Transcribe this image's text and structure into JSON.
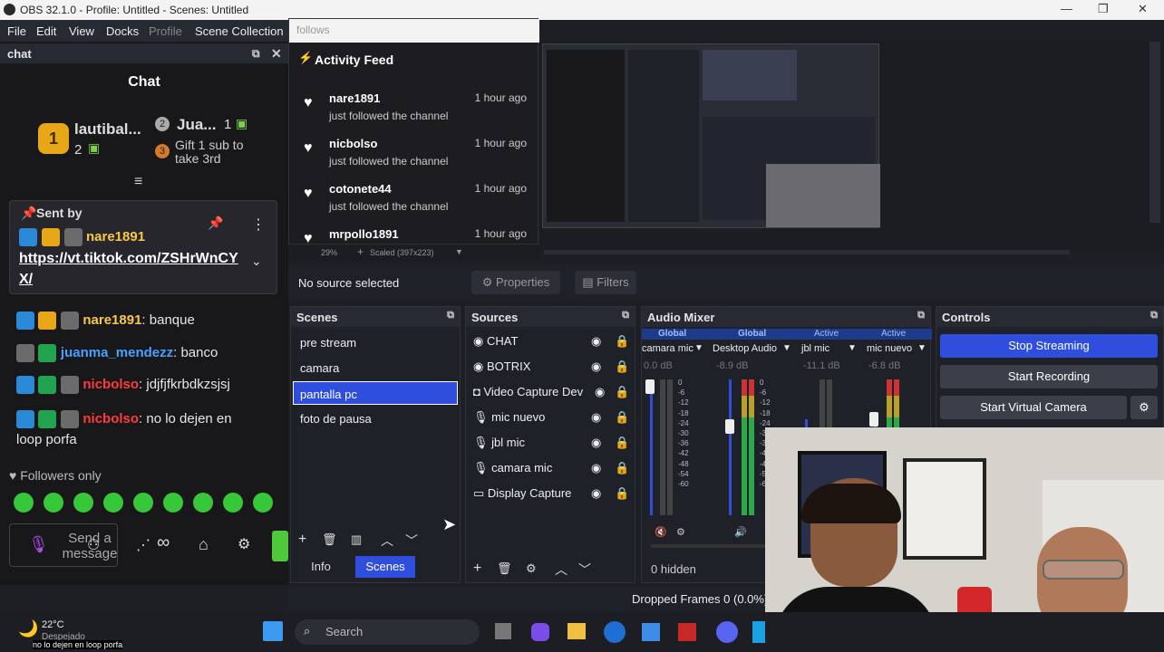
{
  "window": {
    "title": "OBS 32.1.0 - Profile: Untitled - Scenes: Untitled"
  },
  "menu": [
    "File",
    "Edit",
    "View",
    "Docks",
    "Profile",
    "Scene Collection"
  ],
  "chat": {
    "dock_title": "chat",
    "heading": "Chat",
    "top1_name": "lautibal...",
    "top1_count": "2",
    "top2_name": "Jua...",
    "top2_count": "1",
    "top3_text": "Gift 1 sub to take 3rd",
    "pinned_label": "Sent by",
    "pinned_user": "nare1891",
    "pinned_link": "https://vt.tiktok.com/ZSHrWnCYX/",
    "messages": [
      {
        "user": "nare1891",
        "user_color": "#f7c948",
        "text": ": banque"
      },
      {
        "user": "juanma_mendezz",
        "user_color": "#4aa0ff",
        "text": ": banco"
      },
      {
        "user": "nicbolso",
        "user_color": "#ff3b3b",
        "text": ": jdjfjfkrbdkzsjsj"
      },
      {
        "user": "nicbolso",
        "user_color": "#ff3b3b",
        "text": ": no lo dejen en loop porfa"
      }
    ],
    "followers_only": "Followers only",
    "send_placeholder": "Send a message",
    "infinity": "∞"
  },
  "follows": {
    "dock_title": "follows",
    "title": "Activity Feed",
    "items": [
      {
        "name": "nare1891",
        "sub": "just followed the channel",
        "time": "1 hour ago"
      },
      {
        "name": "nicbolso",
        "sub": "just followed the channel",
        "time": "1 hour ago"
      },
      {
        "name": "cotonete44",
        "sub": "just followed the channel",
        "time": "1 hour ago"
      },
      {
        "name": "mrpollo1891",
        "sub": "",
        "time": "1 hour ago"
      }
    ],
    "zoom": "29%",
    "scaled": "Scaled (397x223)"
  },
  "source_bar": {
    "no_source": "No source selected",
    "properties": "Properties",
    "filters": "Filters"
  },
  "scenes": {
    "title": "Scenes",
    "items": [
      "pre stream",
      "camara",
      "pantalla pc",
      "foto de pausa"
    ],
    "selected": "pantalla pc",
    "tab_info": "Info",
    "tab_scenes": "Scenes"
  },
  "sources": {
    "title": "Sources",
    "items": [
      "CHAT",
      "BOTRIX",
      "Video Capture Dev",
      "mic nuevo",
      "jbl mic",
      "camara mic",
      "Display Capture"
    ]
  },
  "audio": {
    "title": "Audio Mixer",
    "channels": [
      {
        "tag": "Global",
        "name": "camara mic",
        "db": "0.0 dB"
      },
      {
        "tag": "Global",
        "name": "Desktop Audio",
        "db": "-8.9 dB"
      },
      {
        "tag": "Active",
        "name": "jbl mic",
        "db": "-11.1 dB"
      },
      {
        "tag": "Active",
        "name": "mic nuevo",
        "db": "-6.8 dB"
      }
    ],
    "scale": [
      "0",
      "-6",
      "-12",
      "-18",
      "-24",
      "-30",
      "-36",
      "-42",
      "-48",
      "-54",
      "-60"
    ],
    "hidden": "0 hidden"
  },
  "controls": {
    "title": "Controls",
    "stop_streaming": "Stop Streaming",
    "start_recording": "Start Recording",
    "start_virtual": "Start Virtual Camera"
  },
  "status": {
    "dropped": "Dropped Frames 0 (0.0%)"
  },
  "taskbar": {
    "temp": "22°C",
    "weather": "Despejado",
    "search": "Search",
    "overlay_text": "no lo dejen en loop porfa"
  }
}
